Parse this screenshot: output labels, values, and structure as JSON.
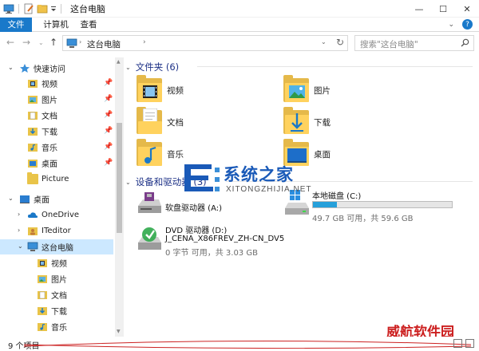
{
  "window": {
    "title": "这台电脑",
    "controls": {
      "minimize": "—",
      "maximize": "☐",
      "close": "✕"
    }
  },
  "ribbon": {
    "tabs": [
      "文件",
      "计算机",
      "查看"
    ],
    "help": "?"
  },
  "address": {
    "path": "这台电脑",
    "search_placeholder": "搜索\"这台电脑\""
  },
  "sidebar": {
    "quick_access": "快速访问",
    "quick_items": [
      {
        "label": "视频",
        "pinned": true
      },
      {
        "label": "图片",
        "pinned": true
      },
      {
        "label": "文档",
        "pinned": true
      },
      {
        "label": "下载",
        "pinned": true
      },
      {
        "label": "音乐",
        "pinned": true
      },
      {
        "label": "桌面",
        "pinned": true
      },
      {
        "label": "Picture",
        "pinned": false
      }
    ],
    "desktop": "桌面",
    "onedrive": "OneDrive",
    "iteditor": "ITeditor",
    "this_pc": "这台电脑",
    "pc_children": [
      "视频",
      "图片",
      "文档",
      "下载",
      "音乐"
    ]
  },
  "content": {
    "folders_header": "文件夹 (6)",
    "folders": [
      "视频",
      "图片",
      "文档",
      "下载",
      "音乐",
      "桌面"
    ],
    "devices_header": "设备和驱动器 (3)",
    "drives": {
      "floppy": {
        "name": "软盘驱动器 (A:)"
      },
      "local": {
        "name": "本地磁盘 (C:)",
        "usage": "49.7 GB 可用，共 59.6 GB",
        "used_fraction": 0.17
      },
      "dvd": {
        "name": "DVD 驱动器 (D:)",
        "label": "J_CENA_X86FREV_ZH-CN_DV5",
        "usage": "0 字节 可用，共 3.03 GB"
      }
    }
  },
  "watermark": {
    "brand": "系统之家",
    "url": "XITONGZHIJIA.NET",
    "corner": "威航软件园"
  },
  "status": {
    "items": "9 个项目"
  }
}
